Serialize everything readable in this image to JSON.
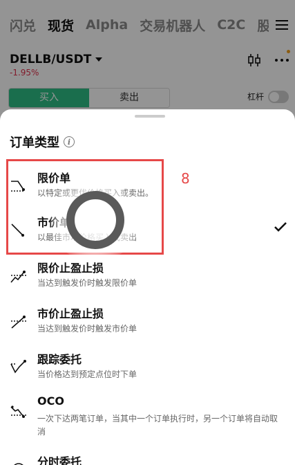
{
  "topnav": {
    "tabs": [
      "闪兑",
      "现货",
      "Alpha",
      "交易机器人",
      "C2C",
      "股"
    ],
    "active": "现货"
  },
  "market": {
    "pair": "DELLB/USDT",
    "change": "-1.95%"
  },
  "trade": {
    "buy_label": "买入",
    "sell_label": "卖出",
    "leverage_label": "杠杆"
  },
  "sheet": {
    "title": "订单类型",
    "options": [
      {
        "title": "限价单",
        "desc": "以特定或更优价格买入或卖出。",
        "icon": "limit-order-icon"
      },
      {
        "title": "市价单",
        "desc": "以最佳市场价格买入或卖出",
        "icon": "market-order-icon",
        "selected": true
      },
      {
        "title": "限价止盈止损",
        "desc": "当达到触发价时触发限价单",
        "icon": "limit-tpsl-icon"
      },
      {
        "title": "市价止盈止损",
        "desc": "当达到触发价时触发市价单",
        "icon": "market-tpsl-icon"
      },
      {
        "title": "跟踪委托",
        "desc": "当价格达到预定点位时下单",
        "icon": "trailing-order-icon"
      },
      {
        "title": "OCO",
        "desc": "一次下达两笔订单，当其中一个订单执行时，另一个订单将自动取消",
        "icon": "oco-icon"
      },
      {
        "title": "分时委托",
        "desc": "",
        "icon": "twap-icon"
      }
    ]
  },
  "annotation": {
    "number": "8",
    "color": "#e64848"
  },
  "colors": {
    "buy": "#2ebd85",
    "negative": "#e0304a"
  }
}
